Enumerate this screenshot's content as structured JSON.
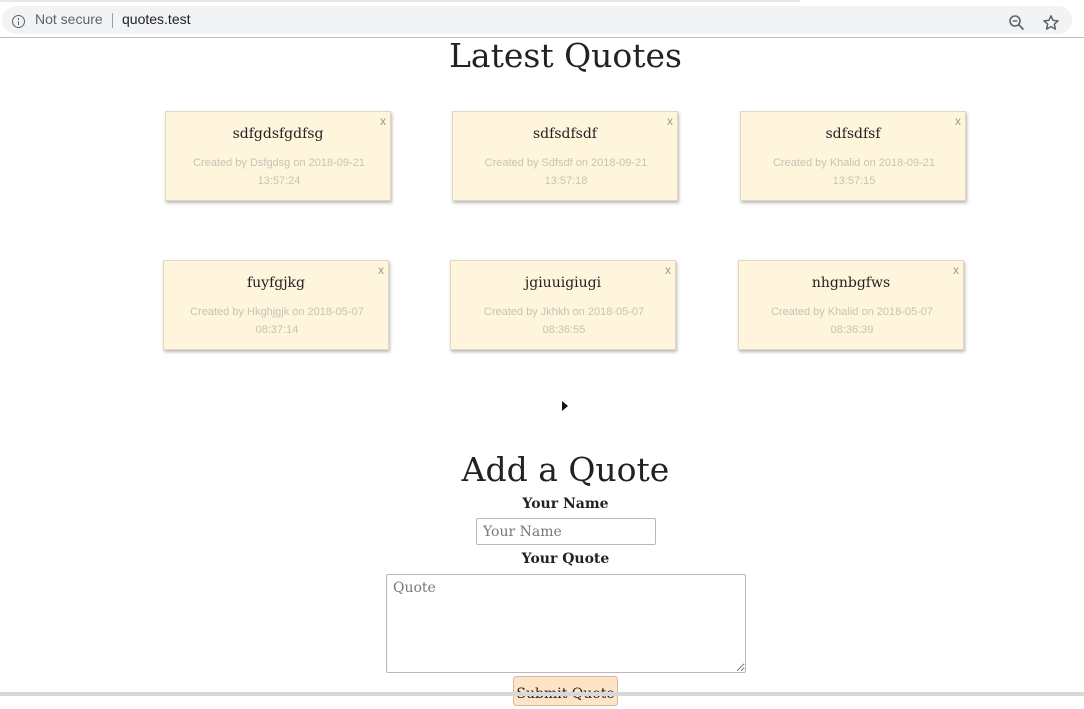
{
  "browser": {
    "security_label": "Not secure",
    "url": "quotes.test",
    "icons": [
      "info-icon",
      "zoom-icon",
      "star-icon"
    ]
  },
  "page": {
    "title": "Latest Quotes"
  },
  "quotes": [
    {
      "text": "sdfgdsfgdfsg",
      "close": "x",
      "meta_line1": "Created by Dsfgdsg on 2018-09-21",
      "meta_line2": "13:57:24"
    },
    {
      "text": "sdfsdfsdf",
      "close": "x",
      "meta_line1": "Created by Sdfsdf on 2018-09-21",
      "meta_line2": "13:57:18"
    },
    {
      "text": "sdfsdfsf",
      "close": "x",
      "meta_line1": "Created by Khalid on 2018-09-21",
      "meta_line2": "13:57:15"
    },
    {
      "text": "fuyfgjkg",
      "close": "x",
      "meta_line1": "Created by Hkghjgjk on 2018-05-07",
      "meta_line2": "08:37:14"
    },
    {
      "text": "jgiuuigiugi",
      "close": "x",
      "meta_line1": "Created by Jkhkh on 2018-05-07",
      "meta_line2": "08:36:55"
    },
    {
      "text": "nhgnbgfws",
      "close": "x",
      "meta_line1": "Created by Khalid on 2018-05-07",
      "meta_line2": "08:36:39"
    }
  ],
  "pagination": {
    "icon": "next-arrow-icon"
  },
  "form": {
    "title": "Add a Quote",
    "name_label": "Your Name",
    "name_placeholder": "Your Name",
    "name_value": "",
    "quote_label": "Your Quote",
    "quote_placeholder": "Quote",
    "quote_value": "",
    "submit_label": "Submit Quote"
  },
  "colors": {
    "card_background": "#fff4dc",
    "submit_background": "#fde3c8",
    "meta_text": "#c9c3b5"
  }
}
